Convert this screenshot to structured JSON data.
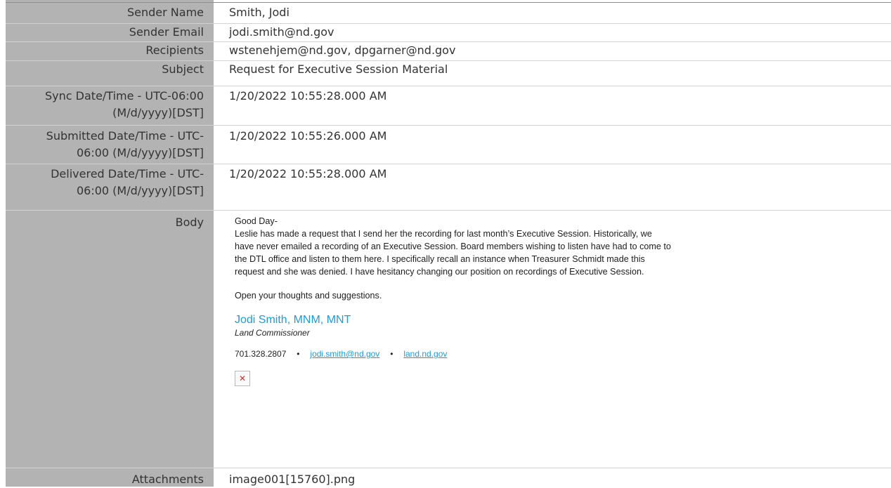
{
  "fields": {
    "sender_name": {
      "label": "Sender Name",
      "value": "Smith, Jodi"
    },
    "sender_email": {
      "label": "Sender Email",
      "value": "jodi.smith@nd.gov"
    },
    "recipients": {
      "label": "Recipients",
      "value": "wstenehjem@nd.gov, dpgarner@nd.gov"
    },
    "subject": {
      "label": "Subject",
      "value": "Request for Executive Session Material"
    },
    "sync": {
      "label_1": "Sync Date/Time - UTC-06:00",
      "label_2": "(M/d/yyyy)[DST]",
      "value": "1/20/2022 10:55:28.000 AM"
    },
    "submitted": {
      "label_1": "Submitted Date/Time - UTC-",
      "label_2": "06:00 (M/d/yyyy)[DST]",
      "value": "1/20/2022 10:55:26.000 AM"
    },
    "delivered": {
      "label_1": "Delivered Date/Time - UTC-",
      "label_2": "06:00 (M/d/yyyy)[DST]",
      "value": "1/20/2022 10:55:28.000 AM"
    },
    "body_label": "Body",
    "attachments": {
      "label": "Attachments",
      "value": "image001[15760].png"
    }
  },
  "body": {
    "greeting": "Good Day-",
    "lines": [
      "Leslie has made a request that I send her the recording for last month’s Executive Session.  Historically, we",
      "have never emailed a recording of an Executive Session. Board members wishing to listen have had to come to",
      "the DTL office and listen to them here.  I specifically recall an instance when Treasurer Schmidt made this",
      "request and she was denied. I have hesitancy changing our position on recordings of Executive Session."
    ],
    "closing": "Open your thoughts and suggestions.",
    "signature": {
      "name": "Jodi Smith, MNM, MNT",
      "title": "Land Commissioner",
      "phone": "701.328.2807",
      "separator": "•",
      "email": "jodi.smith@nd.gov",
      "website": "land.nd.gov",
      "image_icon": "broken-image-icon"
    }
  },
  "colors": {
    "label_column": "#b3b3b3",
    "signature_accent": "#1e9bd7",
    "broken_image_x": "#d12a2a"
  }
}
